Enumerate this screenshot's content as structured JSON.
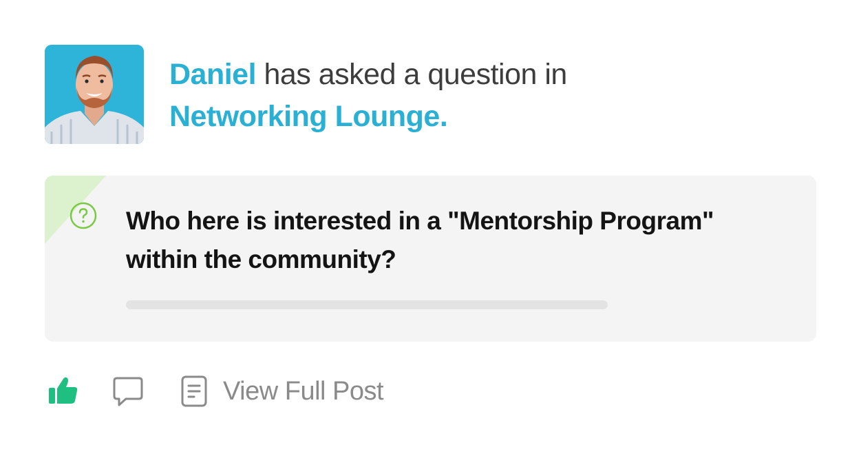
{
  "post": {
    "author": "Daniel",
    "action_text": " has asked a question in",
    "group": "Networking Lounge.",
    "question": "Who here is interested in a \"Mentorship Program\" within the community?"
  },
  "actions": {
    "view_full_post_label": "View Full Post"
  },
  "icons": {
    "avatar": "user-photo",
    "question": "question-circle-icon",
    "like": "thumbs-up-icon",
    "comment": "comment-bubble-icon",
    "document": "document-icon"
  },
  "colors": {
    "accent": "#2ab0d5",
    "like_active": "#1fbf82",
    "question_icon": "#7ac943",
    "card_bg": "#f4f4f4",
    "corner": "#dcf2cf"
  }
}
